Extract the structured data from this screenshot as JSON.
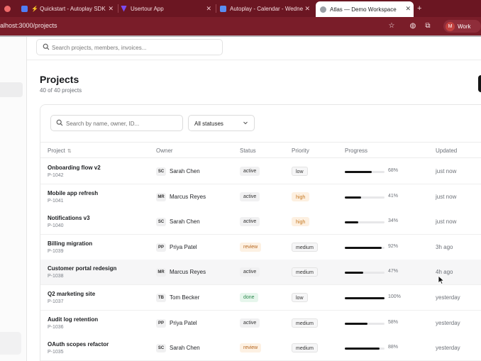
{
  "browser": {
    "tabs": [
      {
        "title": "",
        "favicon_color": "#f06a6a"
      },
      {
        "title": "⚡ Quickstart - Autoplay SDK",
        "favicon_color": "#4f7df5"
      },
      {
        "title": "Usertour App",
        "favicon_color": "#7b4bf2"
      },
      {
        "title": "Autoplay - Calendar - Wedne",
        "favicon_color": "#5a8df2"
      },
      {
        "title": "Atlas — Demo Workspace",
        "favicon_color": "#9aa0a6",
        "active": true
      }
    ],
    "new_tab": "+",
    "url": "alhost:3000/projects",
    "profile": {
      "initial": "M",
      "label": "Work"
    }
  },
  "global_search": {
    "placeholder": "Search projects, members, invoices..."
  },
  "page": {
    "title": "Projects",
    "subtitle": "40 of 40 projects"
  },
  "filters": {
    "search_placeholder": "Search by name, owner, ID...",
    "status_select": "All statuses"
  },
  "table": {
    "columns": {
      "project": "Project",
      "owner": "Owner",
      "status": "Status",
      "priority": "Priority",
      "progress": "Progress",
      "updated": "Updated"
    },
    "rows": [
      {
        "name": "Onboarding flow v2",
        "id": "P-1042",
        "owner_initials": "SC",
        "owner": "Sarah Chen",
        "status": "active",
        "priority": "low",
        "progress": 68,
        "progress_label": "68%",
        "updated": "just now"
      },
      {
        "name": "Mobile app refresh",
        "id": "P-1041",
        "owner_initials": "MR",
        "owner": "Marcus Reyes",
        "status": "active",
        "priority": "high",
        "progress": 41,
        "progress_label": "41%",
        "updated": "just now"
      },
      {
        "name": "Notifications v3",
        "id": "P-1040",
        "owner_initials": "SC",
        "owner": "Sarah Chen",
        "status": "active",
        "priority": "high",
        "progress": 34,
        "progress_label": "34%",
        "updated": "just now"
      },
      {
        "name": "Billing migration",
        "id": "P-1039",
        "owner_initials": "PP",
        "owner": "Priya Patel",
        "status": "review",
        "priority": "medium",
        "progress": 92,
        "progress_label": "92%",
        "updated": "3h ago"
      },
      {
        "name": "Customer portal redesign",
        "id": "P-1038",
        "owner_initials": "MR",
        "owner": "Marcus Reyes",
        "status": "active",
        "priority": "medium",
        "progress": 47,
        "progress_label": "47%",
        "updated": "4h ago"
      },
      {
        "name": "Q2 marketing site",
        "id": "P-1037",
        "owner_initials": "TB",
        "owner": "Tom Becker",
        "status": "done",
        "priority": "low",
        "progress": 100,
        "progress_label": "100%",
        "updated": "yesterday"
      },
      {
        "name": "Audit log retention",
        "id": "P-1036",
        "owner_initials": "PP",
        "owner": "Priya Patel",
        "status": "active",
        "priority": "medium",
        "progress": 58,
        "progress_label": "58%",
        "updated": "yesterday"
      },
      {
        "name": "OAuth scopes refactor",
        "id": "P-1035",
        "owner_initials": "SC",
        "owner": "Sarah Chen",
        "status": "review",
        "priority": "medium",
        "progress": 88,
        "progress_label": "88%",
        "updated": "yesterday"
      }
    ]
  },
  "colors": {
    "tab_bar": "#6b1622",
    "status_review_bg": "#fdf1e3",
    "status_review_fg": "#b5651d",
    "status_done_bg": "#e6f6ec",
    "status_done_fg": "#2f8a4f",
    "priority_high_bg": "#fdf0e1",
    "priority_high_fg": "#c4761e"
  }
}
